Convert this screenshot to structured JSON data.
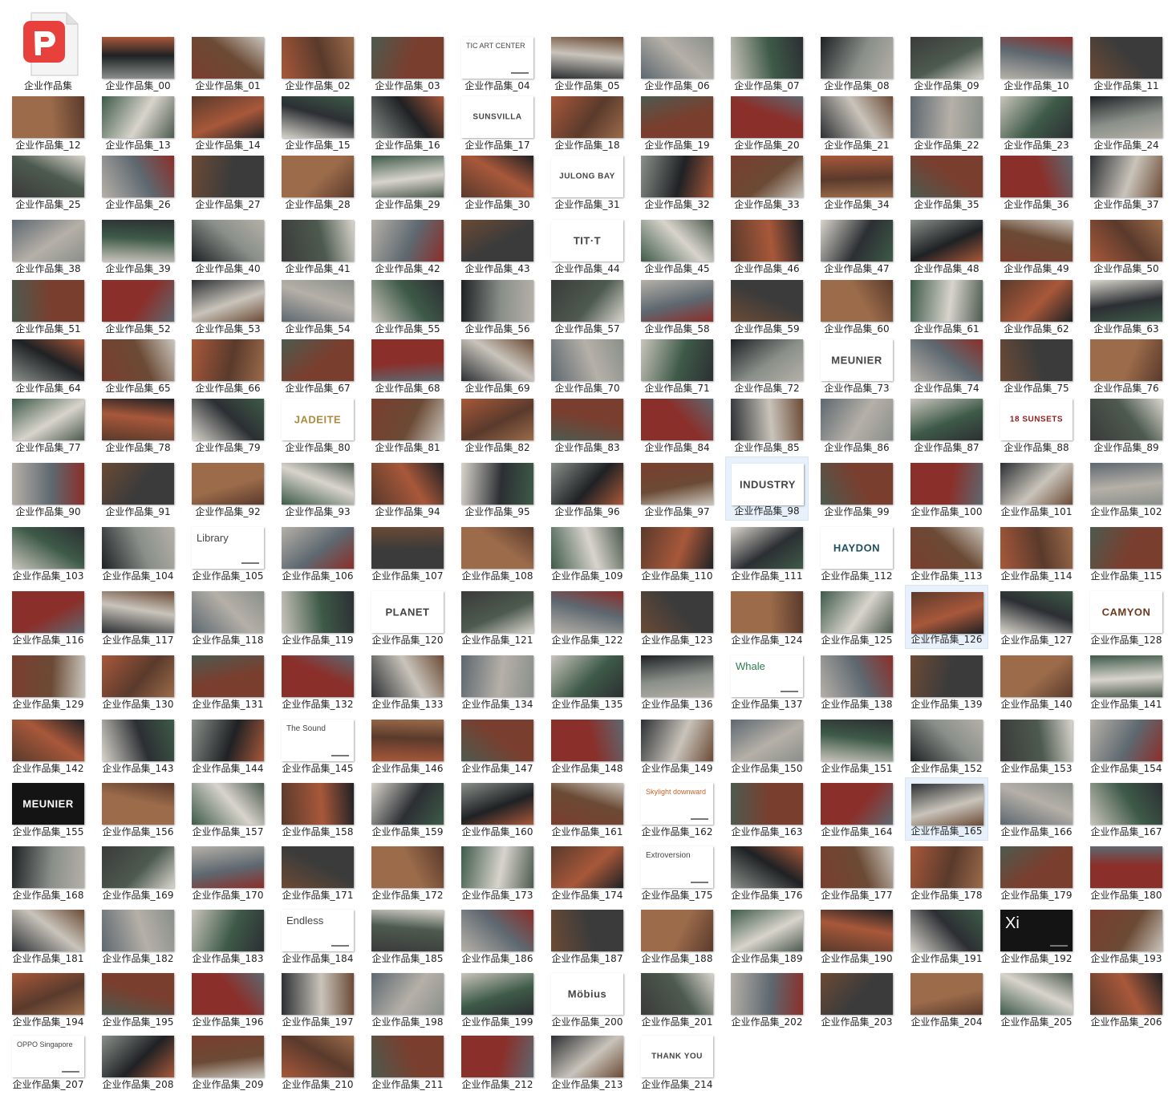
{
  "folder": {
    "pdf_file": {
      "label": "企业作品集",
      "icon": "pdf-file-icon",
      "accent": "#e8403d"
    },
    "item_prefix": "企业作品集_",
    "item_count": 215,
    "selected": [
      "企业作品集_98",
      "企业作品集_126",
      "企业作品集_165"
    ],
    "title_cards": [
      {
        "item": "企业作品集_04",
        "text": "TIC ART CENTER"
      },
      {
        "item": "企业作品集_17",
        "text": "SUNSVILLA"
      },
      {
        "item": "企业作品集_31",
        "text": "JULONG BAY"
      },
      {
        "item": "企业作品集_44",
        "text": "TIT·T"
      },
      {
        "item": "企业作品集_73",
        "text": "MEUNIER"
      },
      {
        "item": "企业作品集_80",
        "text": "JADEITE"
      },
      {
        "item": "企业作品集_88",
        "text": "18 SUNSETS"
      },
      {
        "item": "企业作品集_98",
        "text": "INDUSTRY"
      },
      {
        "item": "企业作品集_105",
        "text": "Library"
      },
      {
        "item": "企业作品集_112",
        "text": "HAYDON"
      },
      {
        "item": "企业作品集_120",
        "text": "PLANET"
      },
      {
        "item": "企业作品集_128",
        "text": "CAMYON"
      },
      {
        "item": "企业作品集_137",
        "text": "Whale"
      },
      {
        "item": "企业作品集_145",
        "text": "The Sound"
      },
      {
        "item": "企业作品集_155",
        "text": "MEUNIER"
      },
      {
        "item": "企业作品集_162",
        "text": "Skylight downward"
      },
      {
        "item": "企业作品集_175",
        "text": "Extroversion"
      },
      {
        "item": "企业作品集_184",
        "text": "Endless"
      },
      {
        "item": "企业作品集_192",
        "text": "Xi"
      },
      {
        "item": "企业作品集_200",
        "text": "Möbius"
      },
      {
        "item": "企业作品集_207",
        "text": "OPPO Singapore"
      },
      {
        "item": "企业作品集_214",
        "text": "THANK YOU"
      }
    ],
    "thumbnail_palette": [
      "#6b4a35",
      "#a8583a",
      "#3b3b3b",
      "#8a8f8a",
      "#c9c4bb",
      "#5a3a2c",
      "#2c2f33",
      "#9b6b4a",
      "#4d5a4f",
      "#b5b0a8",
      "#7a3e2e",
      "#1f2124",
      "#d8d4cc",
      "#5e6870",
      "#3e5a48",
      "#8b2f2a"
    ]
  }
}
